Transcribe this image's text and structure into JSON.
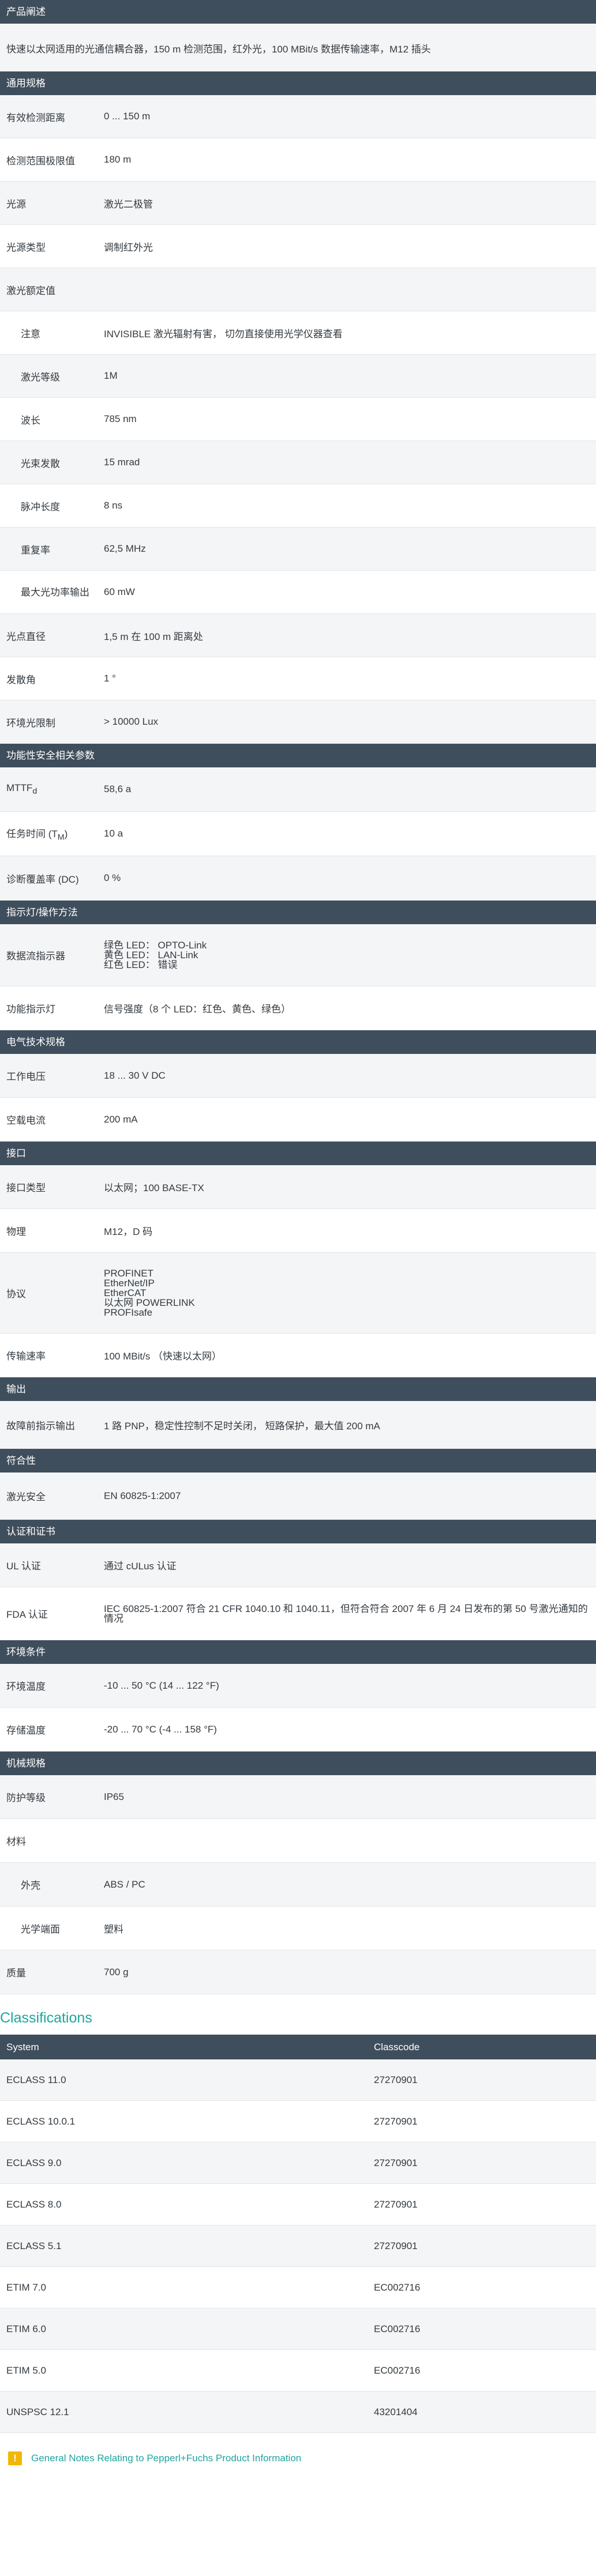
{
  "product_description": {
    "heading": "产品阐述",
    "text": "快速以太网适用的光通信耦合器，150 m 检测范围，红外光，100 MBit/s 数据传输速率，M12 插头"
  },
  "sections": {
    "general": {
      "heading": "通用规格",
      "rows": [
        {
          "k": "有效检测距离",
          "v": "0 ... 150 m"
        },
        {
          "k": "检测范围极限值",
          "v": "180 m"
        },
        {
          "k": "光源",
          "v": "激光二极管"
        },
        {
          "k": "光源类型",
          "v": "调制红外光"
        },
        {
          "k": "激光额定值",
          "v": ""
        },
        {
          "k": "注意",
          "v": "INVISIBLE 激光辐射有害， 切勿直接使用光学仪器查看"
        },
        {
          "k": "激光等级",
          "v": "1M"
        },
        {
          "k": "波长",
          "v": "785 nm"
        },
        {
          "k": "光束发散",
          "v": "15 mrad"
        },
        {
          "k": "脉冲长度",
          "v": "8 ns"
        },
        {
          "k": "重复率",
          "v": "62,5 MHz"
        },
        {
          "k": "最大光功率输出",
          "v": "60 mW"
        },
        {
          "k": "光点直径",
          "v": "1,5 m 在 100 m 距离处"
        },
        {
          "k": "发散角",
          "v": "1 °"
        },
        {
          "k": "环境光限制",
          "v": "> 10000 Lux"
        }
      ]
    },
    "safety": {
      "heading": "功能性安全相关参数",
      "rows": [
        {
          "k": "MTTF",
          "k_sub": "d",
          "v": "58,6 a"
        },
        {
          "k": "任务时间 (T",
          "k_sub": "M",
          "k_after": ")",
          "v": "10 a"
        },
        {
          "k": "诊断覆盖率 (DC)",
          "v": "0 %"
        }
      ]
    },
    "indicators": {
      "heading": "指示灯/操作方法",
      "rows": [
        {
          "k": "数据流指示器",
          "lines": [
            "绿色 LED： OPTO-Link",
            "黄色 LED： LAN-Link",
            "红色 LED： 错误"
          ]
        },
        {
          "k": "功能指示灯",
          "v": "信号强度（8 个 LED：红色、黄色、绿色）"
        }
      ]
    },
    "electrical": {
      "heading": "电气技术规格",
      "rows": [
        {
          "k": "工作电压",
          "v": "18 ... 30 V DC"
        },
        {
          "k": "空载电流",
          "v": "200 mA"
        }
      ]
    },
    "interface": {
      "heading": "接口",
      "rows": [
        {
          "k": "接口类型",
          "v": "以太网；100 BASE-TX"
        },
        {
          "k": "物理",
          "v": "M12，D 码"
        },
        {
          "k": "协议",
          "lines": [
            "PROFINET",
            "EtherNet/IP",
            "EtherCAT",
            "以太网 POWERLINK",
            "PROFIsafe"
          ]
        },
        {
          "k": "传输速率",
          "v": "100 MBit/s （快速以太网）"
        }
      ]
    },
    "output": {
      "heading": "输出",
      "rows": [
        {
          "k": "故障前指示输出",
          "v": "1 路 PNP，稳定性控制不足时关闭， 短路保护，最大值 200 mA"
        }
      ]
    },
    "conformity": {
      "heading": "符合性",
      "rows": [
        {
          "k": "激光安全",
          "v": "EN 60825-1:2007"
        }
      ]
    },
    "approvals": {
      "heading": "认证和证书",
      "rows": [
        {
          "k": "UL 认证",
          "v": "通过 cULus 认证"
        },
        {
          "k": "FDA 认证",
          "lines": [
            "IEC 60825-1:2007 符合 21 CFR 1040.10 和 1040.11，但符合符合 2007 年 6 月 24 日发布的第 50 号激光通知的",
            "情况"
          ]
        }
      ]
    },
    "environment": {
      "heading": "环境条件",
      "rows": [
        {
          "k": "环境温度",
          "v": "-10 ... 50 °C (14 ... 122 °F)"
        },
        {
          "k": "存储温度",
          "v": "-20 ... 70 °C (-4 ... 158 °F)"
        }
      ]
    },
    "mechanical": {
      "heading": "机械规格",
      "rows": [
        {
          "k": "防护等级",
          "v": "IP65"
        },
        {
          "k": "材料",
          "v": ""
        },
        {
          "k": "外壳",
          "v": "ABS / PC"
        },
        {
          "k": "光学端面",
          "v": "塑料"
        },
        {
          "k": "质量",
          "v": "700 g"
        }
      ]
    }
  },
  "classifications": {
    "title": "Classifications",
    "col_system": "System",
    "col_classcode": "Classcode",
    "rows": [
      {
        "system": "ECLASS 11.0",
        "code": "27270901"
      },
      {
        "system": "ECLASS 10.0.1",
        "code": "27270901"
      },
      {
        "system": "ECLASS 9.0",
        "code": "27270901"
      },
      {
        "system": "ECLASS 8.0",
        "code": "27270901"
      },
      {
        "system": "ECLASS 5.1",
        "code": "27270901"
      },
      {
        "system": "ETIM 7.0",
        "code": "EC002716"
      },
      {
        "system": "ETIM 6.0",
        "code": "EC002716"
      },
      {
        "system": "ETIM 5.0",
        "code": "EC002716"
      },
      {
        "system": "UNSPSC 12.1",
        "code": "43201404"
      }
    ]
  },
  "notes": {
    "icon": "warning-icon",
    "link": "General Notes Relating to Pepperl+Fuchs Product Information"
  }
}
